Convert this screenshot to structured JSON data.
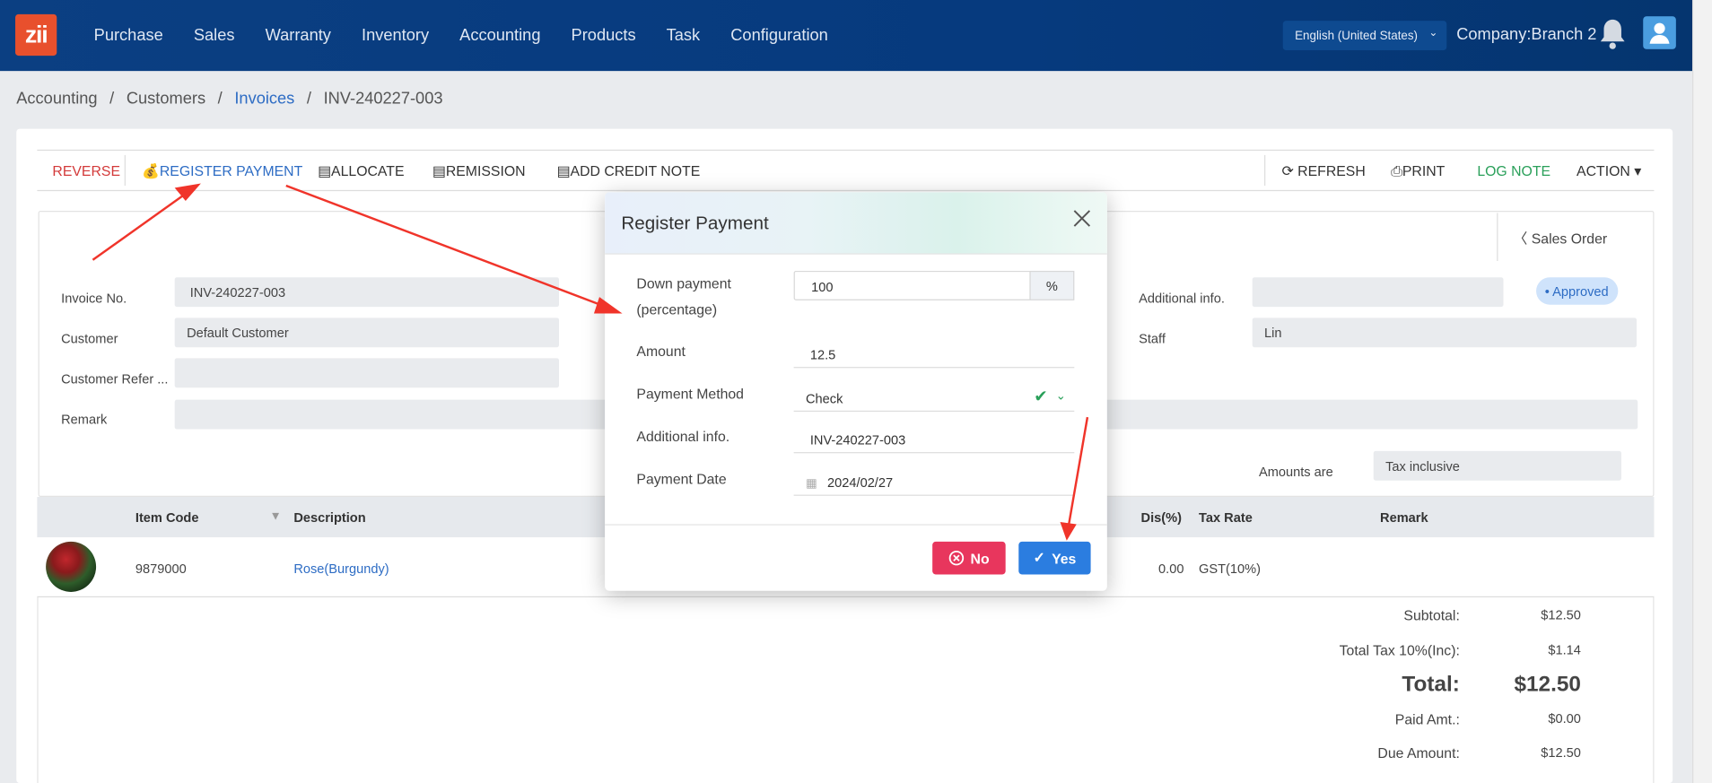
{
  "app": {
    "logo_text": "zii"
  },
  "nav": {
    "items": [
      "Purchase",
      "Sales",
      "Warranty",
      "Inventory",
      "Accounting",
      "Products",
      "Task",
      "Configuration"
    ]
  },
  "header": {
    "language": "English (United States)",
    "company": "Company:Branch 2"
  },
  "breadcrumb": {
    "items": [
      "Accounting",
      "Customers",
      "Invoices",
      "INV-240227-003"
    ],
    "separator": "/"
  },
  "toolbar": {
    "reverse": "REVERSE",
    "register_payment": "REGISTER PAYMENT",
    "allocate": "ALLOCATE",
    "remission": "REMISSION",
    "add_credit_note": "ADD CREDIT NOTE",
    "refresh": "REFRESH",
    "print": "PRINT",
    "log_note": "LOG NOTE",
    "action": "ACTION"
  },
  "form": {
    "sales_order_tab": "Sales Order",
    "invoice_no_label": "Invoice No.",
    "invoice_no": "INV-240227-003",
    "customer_label": "Customer",
    "customer": "Default Customer",
    "customer_ref_label": "Customer Refer ...",
    "remark_label": "Remark",
    "additional_info_label": "Additional info.",
    "status": "Approved",
    "staff_label": "Staff",
    "staff": "Lin",
    "amounts_are_label": "Amounts are",
    "amounts_are": "Tax inclusive"
  },
  "table": {
    "headers": {
      "item_code": "Item Code",
      "description": "Description",
      "dis": "Dis(%)",
      "tax_rate": "Tax Rate",
      "remark": "Remark"
    },
    "rows": [
      {
        "item_code": "9879000",
        "description": "Rose(Burgundy)",
        "dis": "0.00",
        "tax_rate": "GST(10%)"
      }
    ]
  },
  "totals": {
    "subtotal_label": "Subtotal:",
    "subtotal": "$12.50",
    "tax_label": "Total Tax 10%(Inc):",
    "tax": "$1.14",
    "total_label": "Total:",
    "total": "$12.50",
    "paid_label": "Paid Amt.:",
    "paid": "$0.00",
    "due_label": "Due Amount:",
    "due": "$12.50"
  },
  "modal": {
    "title": "Register Payment",
    "down_payment_label_1": "Down payment",
    "down_payment_label_2": "(percentage)",
    "down_payment_value": "100",
    "percent_addon": "%",
    "amount_label": "Amount",
    "amount": "12.5",
    "payment_method_label": "Payment Method",
    "payment_method": "Check",
    "additional_info_label": "Additional info.",
    "additional_info": "INV-240227-003",
    "payment_date_label": "Payment Date",
    "payment_date": "2024/02/27",
    "no_label": "No",
    "yes_label": "Yes"
  },
  "colors": {
    "topbar": "#063a7e",
    "no_button": "#e8365d",
    "yes_button": "#2b7de0",
    "annotation_arrow": "#f0342a"
  }
}
